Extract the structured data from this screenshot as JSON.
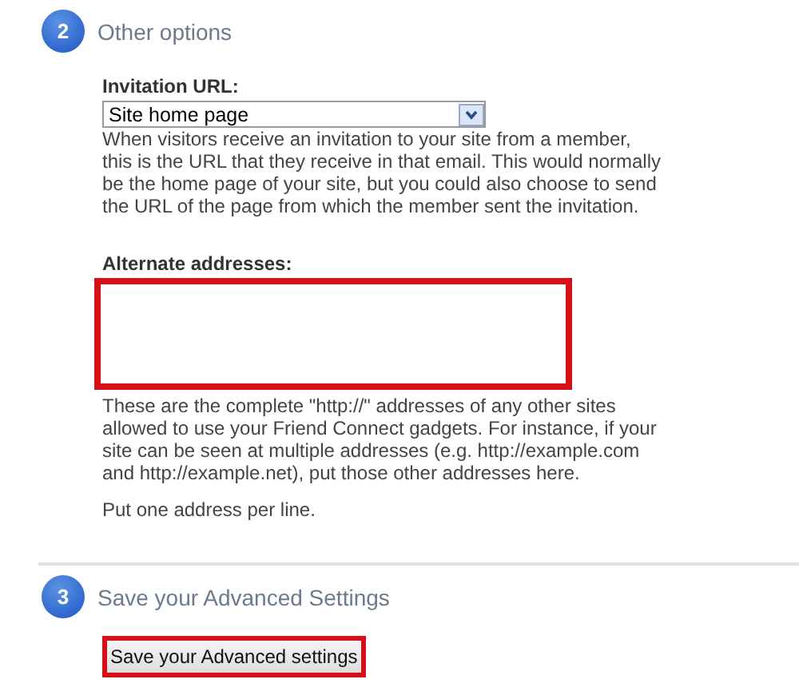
{
  "sections": [
    {
      "number": "2",
      "title": "Other options",
      "kind": "options"
    },
    {
      "number": "3",
      "title": "Save your Advanced Settings",
      "kind": "save"
    }
  ],
  "invitation": {
    "label": "Invitation URL:",
    "value": "Site home page",
    "help": "When visitors receive an invitation to your site from a member, this is the URL that they receive in that email. This would normally be the home page of your site, but you could also choose to send the URL of the page from which the member sent the invitation."
  },
  "alternate": {
    "label": "Alternate addresses:",
    "highlighted": true,
    "help": "These are the complete \"http://\" addresses of any other sites allowed to use your Friend Connect gadgets. For instance, if your site can be seen at multiple addresses (e.g. http://example.com and http://example.net), put those other addresses here.",
    "note": "Put one address per line."
  },
  "save_button": {
    "label": "Save your Advanced settings",
    "highlighted": true
  }
}
